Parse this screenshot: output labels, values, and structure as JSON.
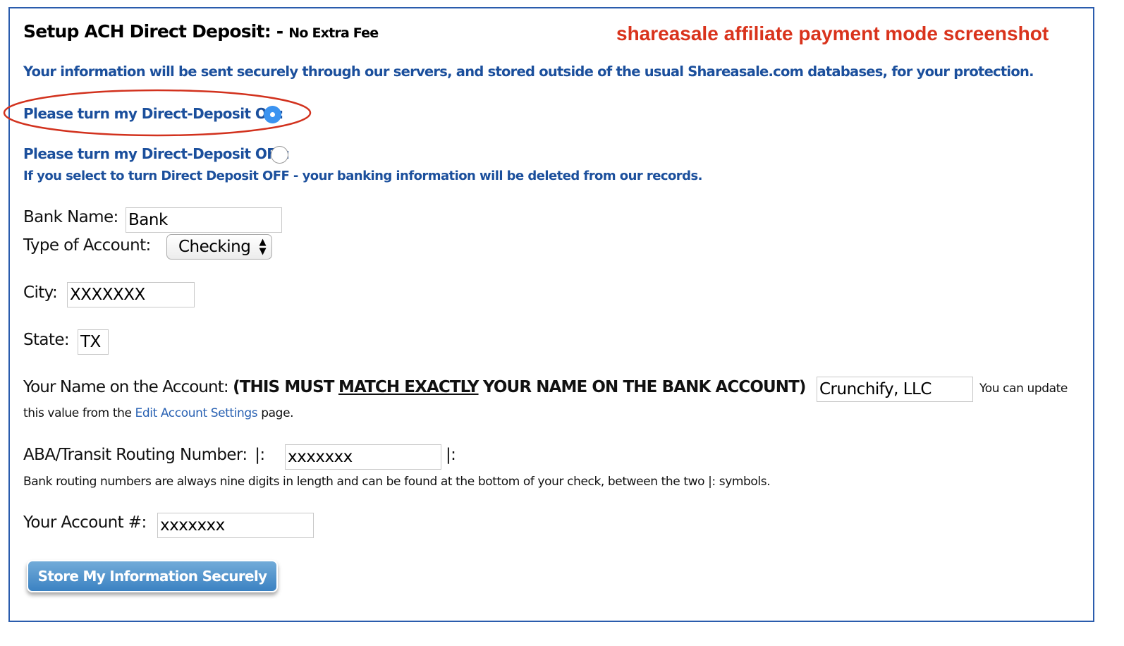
{
  "header": {
    "title": "Setup ACH Direct Deposit:",
    "dash": "-",
    "subtitle": "No Extra Fee",
    "annotation": "shareasale affiliate payment mode screenshot"
  },
  "info_text": "Your information will be sent securely through our servers, and stored outside of the usual Shareasale.com databases, for your protection.",
  "direct_deposit": {
    "on_label": "Please turn my Direct-Deposit ON:",
    "off_label": "Please turn my Direct-Deposit OFF:",
    "selected": "on",
    "off_warning": "If you select to turn Direct Deposit OFF - your banking information will be deleted from our records."
  },
  "form": {
    "bank_name_label": "Bank Name:",
    "bank_name_value": "Bank",
    "account_type_label": "Type of Account:",
    "account_type_value": "Checking",
    "city_label": "City:",
    "city_value": "XXXXXXX",
    "state_label": "State:",
    "state_value": "TX",
    "name_label": "Your Name on the Account:",
    "name_note_open": "(THIS MUST",
    "name_note_underlined": "MATCH EXACTLY",
    "name_note_close": "YOUR NAME ON THE BANK ACCOUNT)",
    "name_value": "Crunchify, LLC",
    "name_help_1": "You can update",
    "name_help_2": "this value from the",
    "name_help_link": "Edit Account Settings",
    "name_help_3": "page.",
    "routing_label": "ABA/Transit Routing Number:",
    "routing_prefix": "|:",
    "routing_value": "xxxxxxx",
    "routing_suffix": "|:",
    "routing_help": "Bank routing numbers are always nine digits in length and can be found at the bottom of your check, between the two |: symbols.",
    "account_label": "Your Account #:",
    "account_value": "xxxxxxx",
    "submit_label": "Store My Information Securely"
  },
  "colors": {
    "accent": "#1b4f9c",
    "annotation": "#d9331c",
    "button": "#3d86c6",
    "radio_selected": "#3b93f0"
  }
}
